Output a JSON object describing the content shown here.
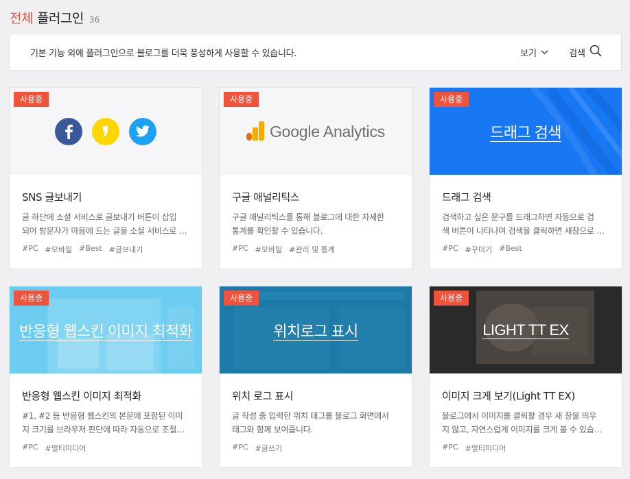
{
  "header": {
    "accent": "전체",
    "title": "플러그인",
    "count": "36"
  },
  "info_bar": {
    "text": "기본 기능 외에 플러그인으로 블로그를 더욱 풍성하게 사용할 수 있습니다.",
    "view_label": "보기",
    "search_label": "검색"
  },
  "colors": {
    "accent": "#f0533b",
    "facebook": "#3b5998",
    "kakao": "#ffd600",
    "twitter": "#1da1f2"
  },
  "cards": [
    {
      "badge": "사용중",
      "thumb_text": "",
      "title": "SNS 글보내기",
      "desc_line1": "글 하단에 소셜 서비스로 글보내기 버튼이 삽입",
      "desc_line2": "되어 방문자가 마음에 드는 글을 소셜 서비스로 보낼 수 있습니다.",
      "tags": [
        "#PC",
        "#모바일",
        "#Best",
        "#글보내기"
      ]
    },
    {
      "badge": "사용중",
      "thumb_text": "Google Analytics",
      "title": "구글 애널리틱스",
      "desc_line1": "구글 애널리틱스를 통해 블로그에 대한 자세한",
      "desc_line2": "통계를 확인할 수 있습니다.",
      "tags": [
        "#PC",
        "#모바일",
        "#관리 및 통계"
      ]
    },
    {
      "badge": "사용중",
      "thumb_text": "드래그 검색",
      "title": "드래그 검색",
      "desc_line1": "검색하고 싶은 문구를 드래그하면 자동으로 검",
      "desc_line2": "색 버튼이 나타나며 검색을 클릭하면 새창으로 열립니다.",
      "tags": [
        "#PC",
        "#꾸미기",
        "#Best"
      ]
    },
    {
      "badge": "사용중",
      "thumb_text": "반응형 웹스킨 이미지 최적화",
      "title": "반응형 웹스킨 이미지 최적화",
      "desc_line1": "#1, #2 등 반응형 웹스킨의 본문에 포함된 이미",
      "desc_line2": "지 크기를 브라우저 판단에 따라 자동으로 조절합니다.",
      "tags": [
        "#PC",
        "#멀티미디어"
      ]
    },
    {
      "badge": "사용중",
      "thumb_text": "위치로그 표시",
      "title": "위치 로그 표시",
      "desc_line1": "글 작성 중 입력한 위치 태그를 블로그 화면에서",
      "desc_line2": "태그와 함께 보여줍니다.",
      "tags": [
        "#PC",
        "#글쓰기"
      ]
    },
    {
      "badge": "사용중",
      "thumb_text": "LIGHT TT EX",
      "title": "이미지 크게 보기(Light TT EX)",
      "desc_line1": "블로그에서 이미지를 클릭할 경우 새 창을 띄우",
      "desc_line2": "지 않고, 자연스럽게 이미지를 크게 볼 수 있습니다.",
      "tags": [
        "#PC",
        "#멀티미디어"
      ]
    }
  ]
}
